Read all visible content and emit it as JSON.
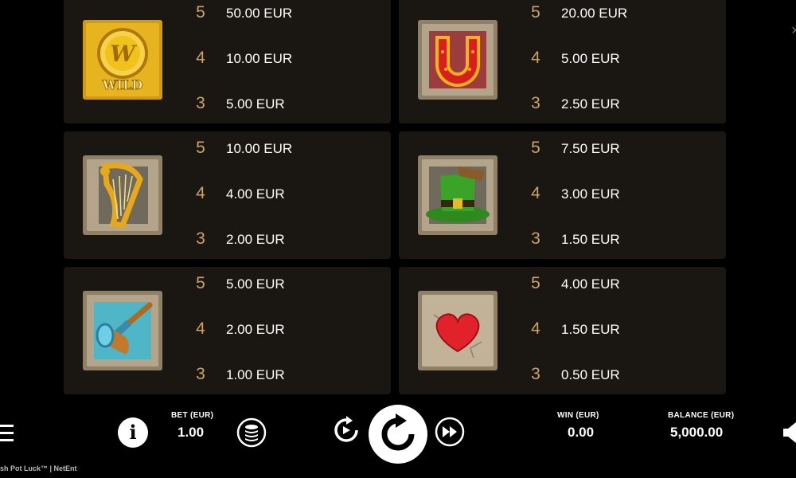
{
  "paytable": {
    "symbols": [
      {
        "name": "wild",
        "logo_text": "WILD",
        "pays": [
          {
            "count": "5",
            "amount": "50.00 EUR"
          },
          {
            "count": "4",
            "amount": "10.00 EUR"
          },
          {
            "count": "3",
            "amount": "5.00 EUR"
          }
        ]
      },
      {
        "name": "horseshoe",
        "pays": [
          {
            "count": "5",
            "amount": "20.00 EUR"
          },
          {
            "count": "4",
            "amount": "5.00 EUR"
          },
          {
            "count": "3",
            "amount": "2.50 EUR"
          }
        ]
      },
      {
        "name": "harp",
        "pays": [
          {
            "count": "5",
            "amount": "10.00 EUR"
          },
          {
            "count": "4",
            "amount": "4.00 EUR"
          },
          {
            "count": "3",
            "amount": "2.00 EUR"
          }
        ]
      },
      {
        "name": "leprechaun-hat",
        "pays": [
          {
            "count": "5",
            "amount": "7.50 EUR"
          },
          {
            "count": "4",
            "amount": "3.00 EUR"
          },
          {
            "count": "3",
            "amount": "1.50 EUR"
          }
        ]
      },
      {
        "name": "pipe",
        "pays": [
          {
            "count": "5",
            "amount": "5.00 EUR"
          },
          {
            "count": "4",
            "amount": "2.00 EUR"
          },
          {
            "count": "3",
            "amount": "1.00 EUR"
          }
        ]
      },
      {
        "name": "heart",
        "pays": [
          {
            "count": "5",
            "amount": "4.00 EUR"
          },
          {
            "count": "4",
            "amount": "1.50 EUR"
          },
          {
            "count": "3",
            "amount": "0.50 EUR"
          }
        ]
      }
    ]
  },
  "bar": {
    "bet_label": "BET (EUR)",
    "bet_value": "1.00",
    "win_label": "WIN (EUR)",
    "win_value": "0.00",
    "balance_label": "BALANCE (EUR)",
    "balance_value": "5,000.00",
    "info_glyph": "i",
    "footer": "sh Pot Luck™  |  NetEnt",
    "close_glyph": "×"
  },
  "icons": {
    "menu": "hamburger-icon",
    "info": "info-icon",
    "coins": "coin-stack-icon",
    "autoplay": "autoplay-icon",
    "spin": "spin-icon",
    "turbo": "fast-forward-icon",
    "sound": "speaker-icon"
  },
  "colors": {
    "card_bg": "#1a1612",
    "count_gold": "#c9a56b",
    "stone": "#a99b82"
  }
}
